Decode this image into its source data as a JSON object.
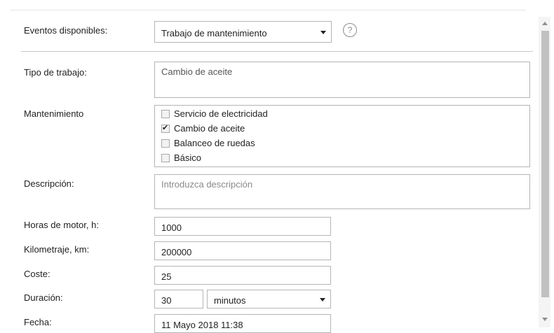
{
  "form": {
    "events_label": "Eventos disponibles:",
    "events_selected": "Trabajo de mantenimiento",
    "help_glyph": "?",
    "work_type_label": "Tipo de trabajo:",
    "work_type_value": "Cambio de aceite",
    "maintenance_label": "Mantenimiento",
    "maintenance_options": [
      {
        "label": "Servicio de electricidad",
        "checked": false
      },
      {
        "label": "Cambio de aceite",
        "checked": true
      },
      {
        "label": "Balanceo de ruedas",
        "checked": false
      },
      {
        "label": "Básico",
        "checked": false
      }
    ],
    "description_label": "Descripción:",
    "description_placeholder": "Introduzca descripción",
    "engine_hours_label": "Horas de motor, h:",
    "engine_hours_value": "1000",
    "mileage_label": "Kilometraje, km:",
    "mileage_value": "200000",
    "cost_label": "Coste:",
    "cost_value": "25",
    "duration_label": "Duración:",
    "duration_value": "30",
    "duration_unit": "minutos",
    "date_label": "Fecha:",
    "date_value": "11 Mayo 2018 11:38"
  },
  "icons": {
    "help": "help-icon",
    "dropdown": "chevron-down-icon",
    "check": "checkmark-icon"
  }
}
